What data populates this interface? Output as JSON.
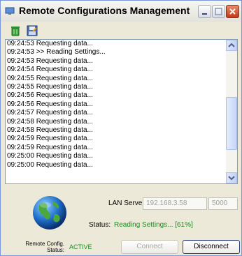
{
  "window": {
    "title": "Remote Configurations Management"
  },
  "toolbar": {
    "icons": [
      "trash-icon",
      "save-icon"
    ]
  },
  "log": {
    "lines": [
      "09:24:53 Requesting data...",
      "09:24:53 >> Reading Settings...",
      "09:24:53 Requesting data...",
      "09:24:54 Requesting data...",
      "09:24:55 Requesting data...",
      "09:24:55 Requesting data...",
      "09:24:56 Requesting data...",
      "09:24:56 Requesting data...",
      "09:24:57 Requesting data...",
      "09:24:58 Requesting data...",
      "09:24:58 Requesting data...",
      "09:24:59 Requesting data...",
      "09:24:59 Requesting data...",
      "09:25:00 Requesting data...",
      "09:25:00 Requesting data..."
    ]
  },
  "lan_server": {
    "label": "LAN Server:",
    "ip": "192.168.3.58",
    "port": "5000"
  },
  "status": {
    "label": "Status:",
    "value": "Reading Settings... [61%]"
  },
  "remote_config": {
    "label_line1": "Remote Config.",
    "label_line2": "Status:",
    "value": "ACTIVE"
  },
  "buttons": {
    "connect": "Connect",
    "disconnect": "Disconnect"
  },
  "colors": {
    "status_green": "#1f8a1f",
    "titlebar_close": "#c0391a"
  }
}
